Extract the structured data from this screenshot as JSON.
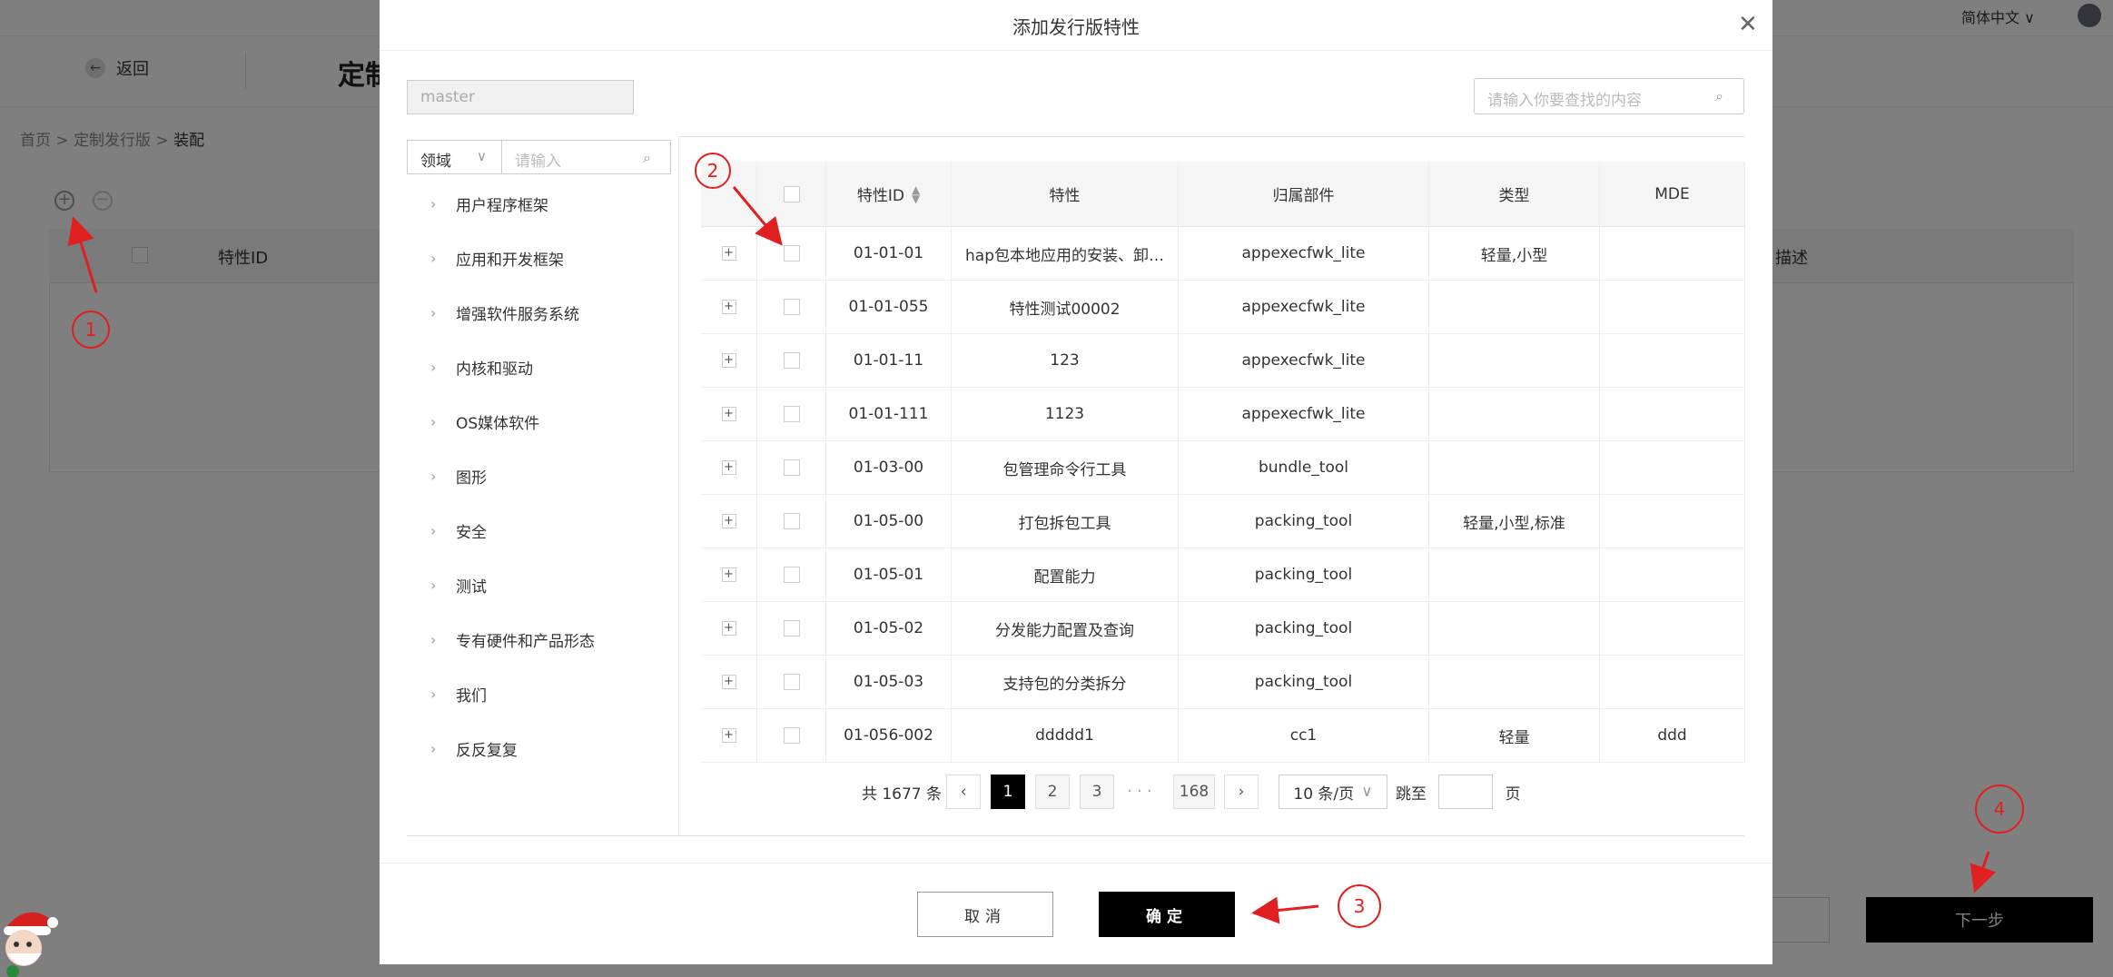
{
  "header": {
    "language": "简体中文"
  },
  "subbar": {
    "back_label": "返回",
    "page_title": "定制"
  },
  "breadcrumb": {
    "home": "首页",
    "sep1": ">",
    "releases": "定制发行版",
    "sep2": ">",
    "current": "装配"
  },
  "bg_table": {
    "col_feature_id": "特性ID",
    "col_desc": "描述"
  },
  "footer": {
    "next_label": "下一步"
  },
  "modal": {
    "title": "添加发行版特性",
    "branch_value": "master",
    "search_placeholder": "请输入你要查找的内容",
    "domain_select": "领域",
    "domain_input_placeholder": "请输入",
    "tree_items": [
      "用户程序框架",
      "应用和开发框架",
      "增强软件服务系统",
      "内核和驱动",
      "OS媒体软件",
      "图形",
      "安全",
      "测试",
      "专有硬件和产品形态",
      "我们",
      "反反复复"
    ],
    "columns": [
      "特性ID",
      "特性",
      "归属部件",
      "类型",
      "MDE"
    ],
    "rows": [
      {
        "id": "01-01-01",
        "feature": "hap包本地应用的安装、卸…",
        "component": "appexecfwk_lite",
        "type": "轻量,小型",
        "mde": ""
      },
      {
        "id": "01-01-055",
        "feature": "特性测试00002",
        "component": "appexecfwk_lite",
        "type": "",
        "mde": ""
      },
      {
        "id": "01-01-11",
        "feature": "123",
        "component": "appexecfwk_lite",
        "type": "",
        "mde": ""
      },
      {
        "id": "01-01-111",
        "feature": "1123",
        "component": "appexecfwk_lite",
        "type": "",
        "mde": ""
      },
      {
        "id": "01-03-00",
        "feature": "包管理命令行工具",
        "component": "bundle_tool",
        "type": "",
        "mde": ""
      },
      {
        "id": "01-05-00",
        "feature": "打包拆包工具",
        "component": "packing_tool",
        "type": "轻量,小型,标准",
        "mde": ""
      },
      {
        "id": "01-05-01",
        "feature": "配置能力",
        "component": "packing_tool",
        "type": "",
        "mde": ""
      },
      {
        "id": "01-05-02",
        "feature": "分发能力配置及查询",
        "component": "packing_tool",
        "type": "",
        "mde": ""
      },
      {
        "id": "01-05-03",
        "feature": "支持包的分类拆分",
        "component": "packing_tool",
        "type": "",
        "mde": ""
      },
      {
        "id": "01-056-002",
        "feature": "ddddd1",
        "component": "cc1",
        "type": "轻量",
        "mde": "ddd"
      }
    ],
    "pagination": {
      "total": "共 1677 条",
      "pages": [
        "1",
        "2",
        "3"
      ],
      "ellipsis": "· · ·",
      "last": "168",
      "page_size": "10 条/页",
      "jump_label": "跳至",
      "page_suffix": "页"
    },
    "cancel_label": "取消",
    "ok_label": "确定"
  },
  "annotations": [
    "1",
    "2",
    "3",
    "4"
  ]
}
